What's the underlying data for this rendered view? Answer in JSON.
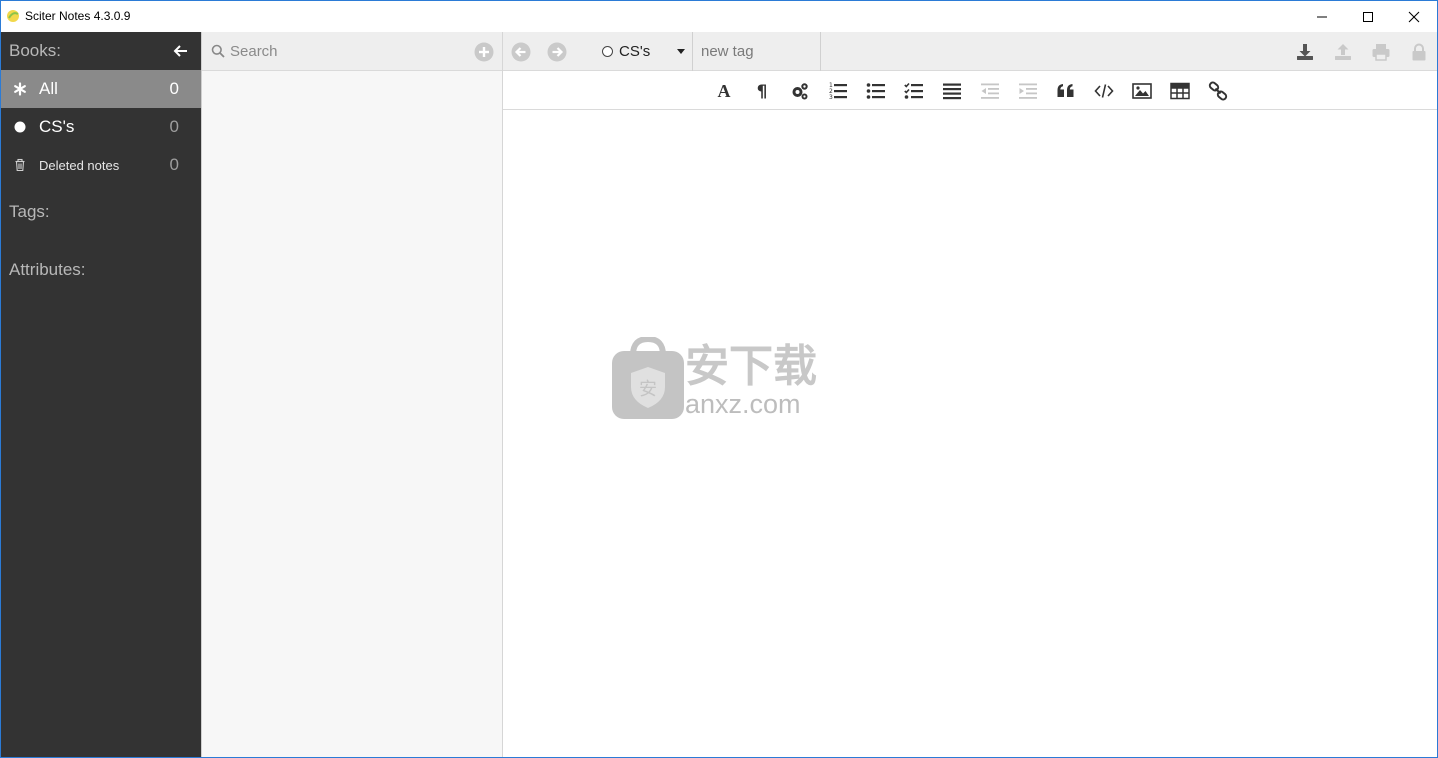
{
  "window": {
    "title": "Sciter Notes 4.3.0.9",
    "controls": [
      "minimize-icon",
      "maximize-icon",
      "close-icon"
    ]
  },
  "sidebar": {
    "books_label": "Books:",
    "books": [
      {
        "label": "All",
        "count": "0",
        "icon": "asterisk-icon",
        "active": true
      },
      {
        "label": "CS's",
        "count": "0",
        "icon": "circle-icon",
        "active": false
      },
      {
        "label": "Deleted notes",
        "count": "0",
        "icon": "trash-icon",
        "active": false
      }
    ],
    "tags_label": "Tags:",
    "attributes_label": "Attributes:"
  },
  "notelist": {
    "search_placeholder": "Search"
  },
  "editor": {
    "book_selected": "CS's",
    "tag_placeholder": "new tag",
    "format_tools": [
      "font-icon",
      "paragraph-icon",
      "gears-icon",
      "ordered-list-icon",
      "bullet-list-icon",
      "checklist-icon",
      "justify-icon",
      "outdent-icon",
      "indent-icon",
      "quote-icon",
      "code-icon",
      "image-icon",
      "table-icon",
      "link-icon"
    ],
    "actions": [
      "download-icon",
      "upload-icon",
      "print-icon",
      "lock-icon"
    ]
  },
  "watermark": {
    "text": "anxz.com"
  },
  "colors": {
    "sidebar_bg": "#333333",
    "active_item_bg": "#8a8a8a",
    "toolbar_bg": "#eeeeee",
    "notelist_bg": "#f7f7f7"
  }
}
